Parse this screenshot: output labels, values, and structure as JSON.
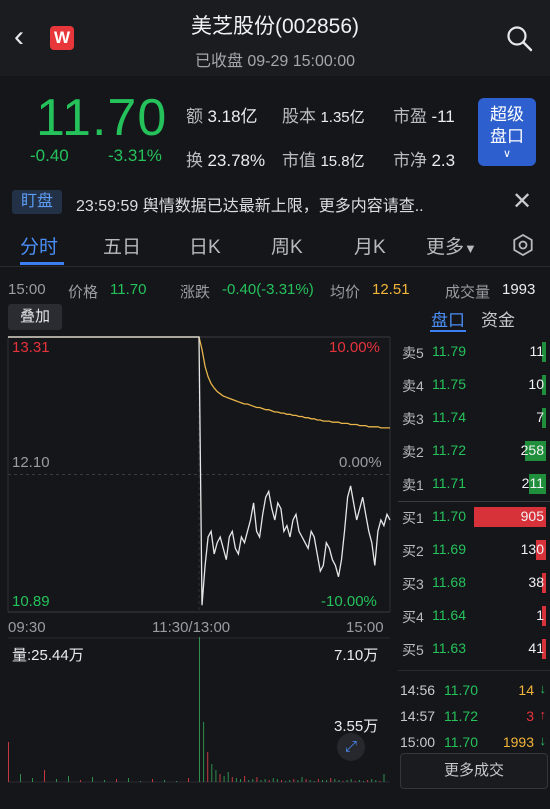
{
  "header": {
    "title": "美芝股份(002856)",
    "subtitle": "已收盘 09-29 15:00:00",
    "logo_text": "W"
  },
  "quote": {
    "price": "11.70",
    "change": "-0.40",
    "change_pct": "-3.31%",
    "stats": [
      {
        "label": "额",
        "value": "3.18亿"
      },
      {
        "label": "股本",
        "value": "1.35亿"
      },
      {
        "label": "市盈",
        "value": "-11"
      },
      {
        "label": "换",
        "value": "23.78%"
      },
      {
        "label": "市值",
        "value": "15.8亿"
      },
      {
        "label": "市净",
        "value": "2.3"
      }
    ],
    "super_button": [
      "超级",
      "盘口"
    ]
  },
  "news": {
    "tag": "盯盘",
    "text": "23:59:59 舆情数据已达最新上限，更多内容请查.."
  },
  "tabs": [
    "分时",
    "五日",
    "日K",
    "周K",
    "月K",
    "更多"
  ],
  "info_row": {
    "time": "15:00",
    "price_label": "价格",
    "price_value": "11.70",
    "change_label": "涨跌",
    "change_value": "-0.40(-3.31%)",
    "avg_label": "均价",
    "avg_value": "12.51",
    "volume_label": "成交量",
    "volume_value": "1993"
  },
  "overlay_button": "叠加",
  "side_tabs": [
    "盘口",
    "资金"
  ],
  "chart_data": {
    "type": "line",
    "price_axis": {
      "top": "13.31",
      "mid": "12.10",
      "bottom": "10.89"
    },
    "pct_axis": {
      "top": "10.00%",
      "mid": "0.00%",
      "bottom": "-10.00%"
    },
    "ylim": [
      10.89,
      13.31
    ],
    "x_ticks": [
      "09:30",
      "11:30/13:00",
      "15:00"
    ],
    "volume_label": "量:25.44万",
    "volume_max": "7.10万",
    "volume_mid": "3.55万",
    "series": [
      {
        "name": "价格",
        "color": "#e6e6e6",
        "values": [
          13.31,
          13.31,
          13.31,
          13.31,
          13.31,
          13.31,
          13.31,
          13.31,
          13.31,
          13.31,
          13.31,
          13.31,
          13.31,
          13.31,
          13.31,
          13.31,
          13.31,
          13.31,
          13.31,
          13.31,
          13.31,
          13.31,
          13.31,
          13.31,
          13.31,
          13.31,
          13.31,
          13.31,
          13.31,
          13.31,
          13.31,
          13.31,
          13.31,
          13.31,
          13.31,
          13.31,
          13.31,
          13.31,
          13.31,
          13.31,
          13.31,
          13.31,
          13.31,
          13.31,
          13.31,
          13.31,
          13.31,
          13.31,
          13.31,
          13.31,
          13.31,
          13.31,
          13.31,
          13.31,
          13.31,
          13.31,
          13.31,
          13.31,
          13.31,
          13.31,
          13.31,
          13.31,
          13.31,
          13.31,
          13.31,
          13.31,
          13.31,
          13.31,
          13.31,
          13.31,
          13.31,
          13.31,
          13.31,
          13.31,
          13.31,
          13.31,
          13.31,
          13.31,
          13.31,
          13.31,
          13.31,
          13.31,
          13.31,
          13.31,
          13.31,
          13.31,
          13.31,
          13.31,
          13.31,
          13.31,
          13.31,
          13.31,
          13.31,
          13.31,
          13.31,
          13.31,
          13.31,
          13.31,
          13.31,
          13.31,
          13.31,
          13.31,
          13.31,
          13.31,
          13.31,
          13.31,
          13.31,
          13.31,
          13.31,
          13.31,
          13.31,
          13.31,
          13.31,
          13.31,
          13.31,
          13.31,
          13.31,
          13.31,
          13.31,
          13.31,
          13.31,
          13.31,
          13.31,
          13.31,
          13.31,
          13.31,
          13.31,
          13.31,
          13.31,
          13.31,
          13.31,
          13.31,
          13.31,
          13.31,
          13.31,
          13.31,
          13.31,
          13.31,
          13.31,
          13.31,
          13.31,
          13.31,
          13.31,
          13.31,
          13.31,
          13.31,
          13.31,
          13.31,
          13.31,
          13.31,
          13.31,
          13.31,
          13.31,
          13.31,
          13.31,
          13.31,
          13.31,
          13.31,
          13.31,
          13.31,
          13.31,
          13.31,
          13.31,
          13.31,
          13.31,
          13.31,
          13.31,
          13.31,
          13.31,
          13.31,
          13.31,
          13.31,
          13.31,
          13.31,
          13.31,
          13.31,
          13.31,
          13.31,
          13.31,
          13.31,
          13.31,
          13.31,
          13.31,
          13.31,
          13.31,
          13.31,
          13.31,
          13.31,
          13.31,
          13.31,
          13.31,
          13.31,
          13.31,
          13.31,
          13.31,
          13.31,
          13.31,
          13.31,
          10.95,
          11.3,
          11.55,
          11.6,
          11.4,
          11.5,
          11.55,
          11.45,
          11.35,
          11.55,
          11.6,
          11.45,
          11.4,
          11.55,
          11.5,
          11.6,
          11.7,
          11.85,
          11.6,
          11.55,
          11.75,
          11.9,
          11.95,
          11.8,
          11.7,
          11.85,
          11.8,
          11.6,
          11.65,
          11.55,
          11.7,
          11.75,
          11.6,
          11.55,
          11.5,
          11.45,
          11.6,
          11.55,
          11.4,
          11.25,
          11.3,
          11.5,
          11.45,
          11.35,
          11.3,
          11.2,
          11.35,
          11.6,
          11.9,
          12.0,
          11.85,
          11.7,
          11.8,
          11.9,
          11.75,
          11.6,
          11.5,
          11.3,
          11.6,
          11.7,
          11.65,
          11.75,
          11.7
        ]
      },
      {
        "name": "均价",
        "color": "#e8b54a",
        "values": [
          13.31,
          13.31,
          13.31,
          13.31,
          13.31,
          13.31,
          13.31,
          13.31,
          13.31,
          13.31,
          13.31,
          13.31,
          13.31,
          13.31,
          13.31,
          13.31,
          13.31,
          13.31,
          13.31,
          13.31,
          13.31,
          13.31,
          13.31,
          13.31,
          13.31,
          13.31,
          13.31,
          13.31,
          13.31,
          13.31,
          13.31,
          13.31,
          13.31,
          13.31,
          13.31,
          13.31,
          13.31,
          13.31,
          13.31,
          13.31,
          13.31,
          13.31,
          13.31,
          13.31,
          13.31,
          13.31,
          13.31,
          13.31,
          13.31,
          13.31,
          13.31,
          13.31,
          13.31,
          13.31,
          13.31,
          13.31,
          13.31,
          13.31,
          13.31,
          13.31,
          13.31,
          13.31,
          13.31,
          13.31,
          13.31,
          13.31,
          13.31,
          13.31,
          13.31,
          13.31,
          13.31,
          13.31,
          13.31,
          13.31,
          13.31,
          13.31,
          13.31,
          13.31,
          13.31,
          13.31,
          13.31,
          13.31,
          13.31,
          13.31,
          13.31,
          13.31,
          13.31,
          13.31,
          13.31,
          13.31,
          13.31,
          13.31,
          13.31,
          13.31,
          13.31,
          13.31,
          13.31,
          13.31,
          13.31,
          13.31,
          13.31,
          13.31,
          13.31,
          13.31,
          13.31,
          13.31,
          13.31,
          13.31,
          13.31,
          13.31,
          13.31,
          13.31,
          13.31,
          13.31,
          13.31,
          13.31,
          13.31,
          13.31,
          13.31,
          13.31,
          13.31,
          13.31,
          13.31,
          13.31,
          13.31,
          13.31,
          13.31,
          13.31,
          13.31,
          13.31,
          13.31,
          13.31,
          13.31,
          13.31,
          13.31,
          13.31,
          13.31,
          13.31,
          13.31,
          13.31,
          13.31,
          13.31,
          13.31,
          13.31,
          13.31,
          13.31,
          13.31,
          13.31,
          13.31,
          13.31,
          13.31,
          13.31,
          13.31,
          13.31,
          13.31,
          13.31,
          13.31,
          13.31,
          13.31,
          13.31,
          13.31,
          13.31,
          13.31,
          13.31,
          13.31,
          13.31,
          13.31,
          13.31,
          13.31,
          13.31,
          13.31,
          13.31,
          13.31,
          13.31,
          13.31,
          13.31,
          13.31,
          13.31,
          13.31,
          13.31,
          13.31,
          13.31,
          13.31,
          13.31,
          13.31,
          13.31,
          13.31,
          13.31,
          13.31,
          13.31,
          13.31,
          13.31,
          13.31,
          13.31,
          13.2,
          13.05,
          12.96,
          12.9,
          12.86,
          12.83,
          12.81,
          12.79,
          12.78,
          12.77,
          12.76,
          12.75,
          12.74,
          12.73,
          12.72,
          12.72,
          12.71,
          12.7,
          12.69,
          12.69,
          12.68,
          12.67,
          12.67,
          12.66,
          12.65,
          12.65,
          12.64,
          12.64,
          12.63,
          12.63,
          12.62,
          12.62,
          12.61,
          12.61,
          12.6,
          12.6,
          12.59,
          12.59,
          12.58,
          12.58,
          12.57,
          12.57,
          12.57,
          12.56,
          12.56,
          12.56,
          12.55,
          12.55,
          12.55,
          12.54,
          12.54,
          12.54,
          12.53,
          12.53,
          12.53,
          12.52,
          12.52,
          12.52,
          12.52,
          12.51,
          12.51,
          12.51,
          12.51
        ]
      }
    ]
  },
  "orderbook": {
    "asks": [
      {
        "label": "卖5",
        "price": "11.79",
        "vol": "11",
        "bar": 0.01
      },
      {
        "label": "卖4",
        "price": "11.75",
        "vol": "10",
        "bar": 0.01
      },
      {
        "label": "卖3",
        "price": "11.74",
        "vol": "7",
        "bar": 0.01
      },
      {
        "label": "卖2",
        "price": "11.72",
        "vol": "258",
        "bar": 0.29
      },
      {
        "label": "卖1",
        "price": "11.71",
        "vol": "211",
        "bar": 0.23
      }
    ],
    "bids": [
      {
        "label": "买1",
        "price": "11.70",
        "vol": "905",
        "bar": 1.0
      },
      {
        "label": "买2",
        "price": "11.69",
        "vol": "130",
        "bar": 0.14
      },
      {
        "label": "买3",
        "price": "11.68",
        "vol": "38",
        "bar": 0.04
      },
      {
        "label": "买4",
        "price": "11.64",
        "vol": "1",
        "bar": 0.01
      },
      {
        "label": "买5",
        "price": "11.63",
        "vol": "41",
        "bar": 0.05
      }
    ],
    "trades": [
      {
        "time": "14:56",
        "price": "11.70",
        "vol": "14",
        "dir": "down",
        "color": "#f2b539"
      },
      {
        "time": "14:57",
        "price": "11.72",
        "vol": "3",
        "dir": "up",
        "color": "#e5333c"
      },
      {
        "time": "15:00",
        "price": "11.70",
        "vol": "1993",
        "dir": "down",
        "color": "#f2b539"
      }
    ],
    "more_button": "更多成交"
  }
}
